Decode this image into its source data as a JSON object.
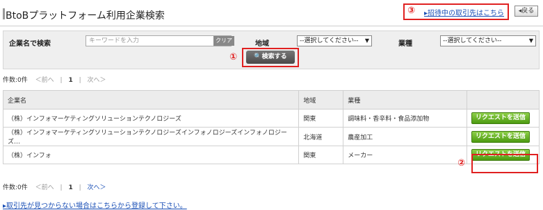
{
  "header": {
    "title": "BtoBプラットフォーム利用企業検索",
    "invite_marker": "③",
    "invite_link": "▸招待中の取引先はこちら",
    "back_button": "◂戻る"
  },
  "search": {
    "company_label": "企業名で検索",
    "keyword_placeholder": "キーワードを入力",
    "clear_button": "クリア",
    "region_label": "地域",
    "region_select": "--選択してください--",
    "industry_label": "業種",
    "industry_select": "--選択してください--",
    "search_marker": "①",
    "search_button": "🔍検索する"
  },
  "pager_top": {
    "count": "件数:0件",
    "prev": "＜前へ",
    "sep1": "|",
    "page": "1",
    "sep2": "|",
    "next": "次へ＞"
  },
  "table": {
    "headers": [
      "企業名",
      "地域",
      "業種",
      ""
    ],
    "rows": [
      {
        "company": "（株）インフォマーケティングソリューションテクノロジーズ",
        "region": "関東",
        "industry": "調味料・香辛料・食品添加物",
        "action": "リクエストを送信"
      },
      {
        "company": "（株）インフォマーケティングソリューションテクノロジーズインフォノロジーズインフォノロジーズ…",
        "region": "北海道",
        "industry": "農産加工",
        "action": "リクエストを送信"
      },
      {
        "company": "（株）インフォ",
        "region": "関東",
        "industry": "メーカー",
        "action": "リクエストを送信"
      }
    ],
    "request_marker": "②"
  },
  "pager_bottom": {
    "count": "件数:0件",
    "prev": "＜前へ",
    "sep1": "|",
    "page": "1",
    "sep2": "|",
    "next": "次へ＞"
  },
  "footer": {
    "link": "▸取引先が見つからない場合はこちらから登録して下さい。"
  }
}
